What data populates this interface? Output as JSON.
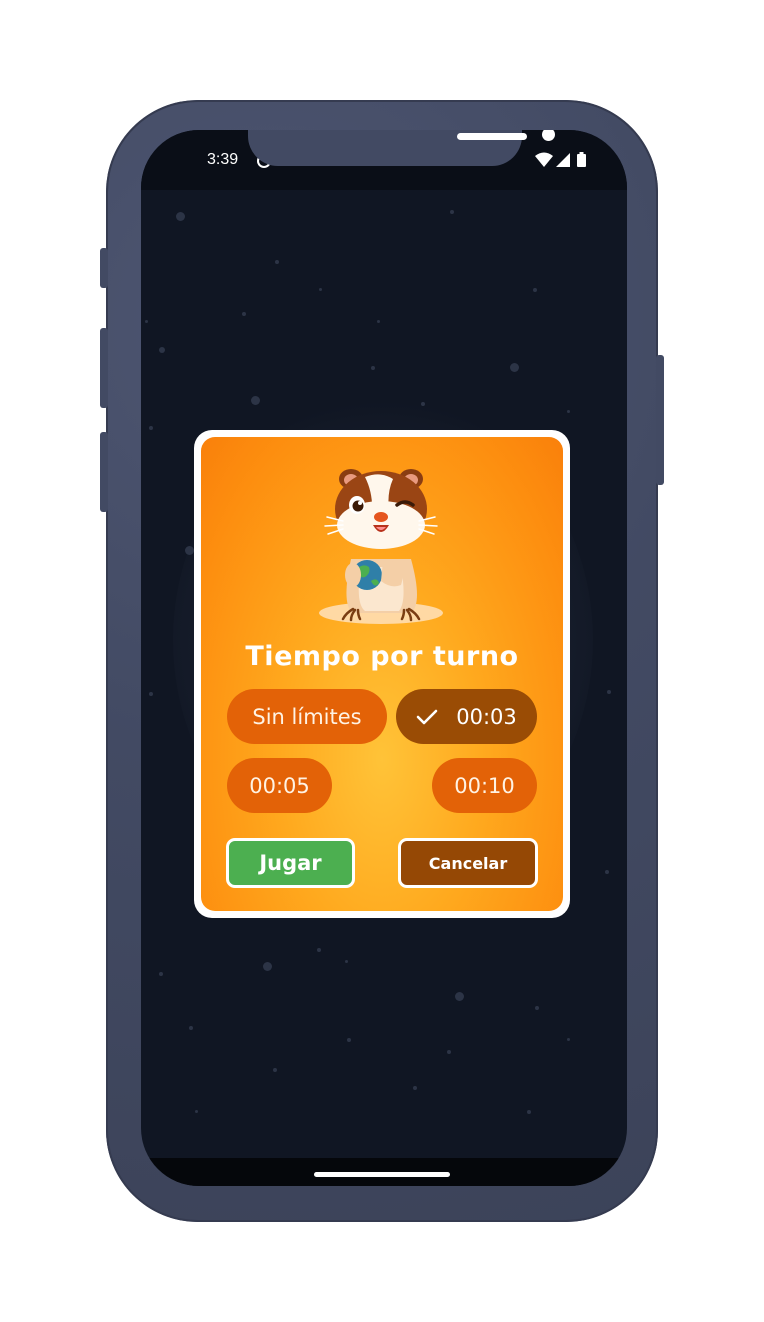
{
  "status_bar": {
    "time": "3:39",
    "icons": [
      "sync-icon",
      "wifi-icon",
      "signal-icon",
      "battery-icon"
    ]
  },
  "dialog": {
    "title": "Tiempo por turno",
    "mascot": "hamster-holding-globe",
    "options": [
      {
        "label": "Sin límites",
        "selected": false
      },
      {
        "label": "00:03",
        "selected": true
      },
      {
        "label": "00:05",
        "selected": false
      },
      {
        "label": "00:10",
        "selected": false
      }
    ],
    "play_label": "Jugar",
    "cancel_label": "Cancelar"
  },
  "colors": {
    "background": "#101623",
    "dialog_orange": "#fd8e0f",
    "option_pill": "#e36207",
    "option_selected": "#9a4c05",
    "play_green": "#4caf50",
    "cancel_brown": "#954805",
    "device_frame": "#424a63"
  }
}
